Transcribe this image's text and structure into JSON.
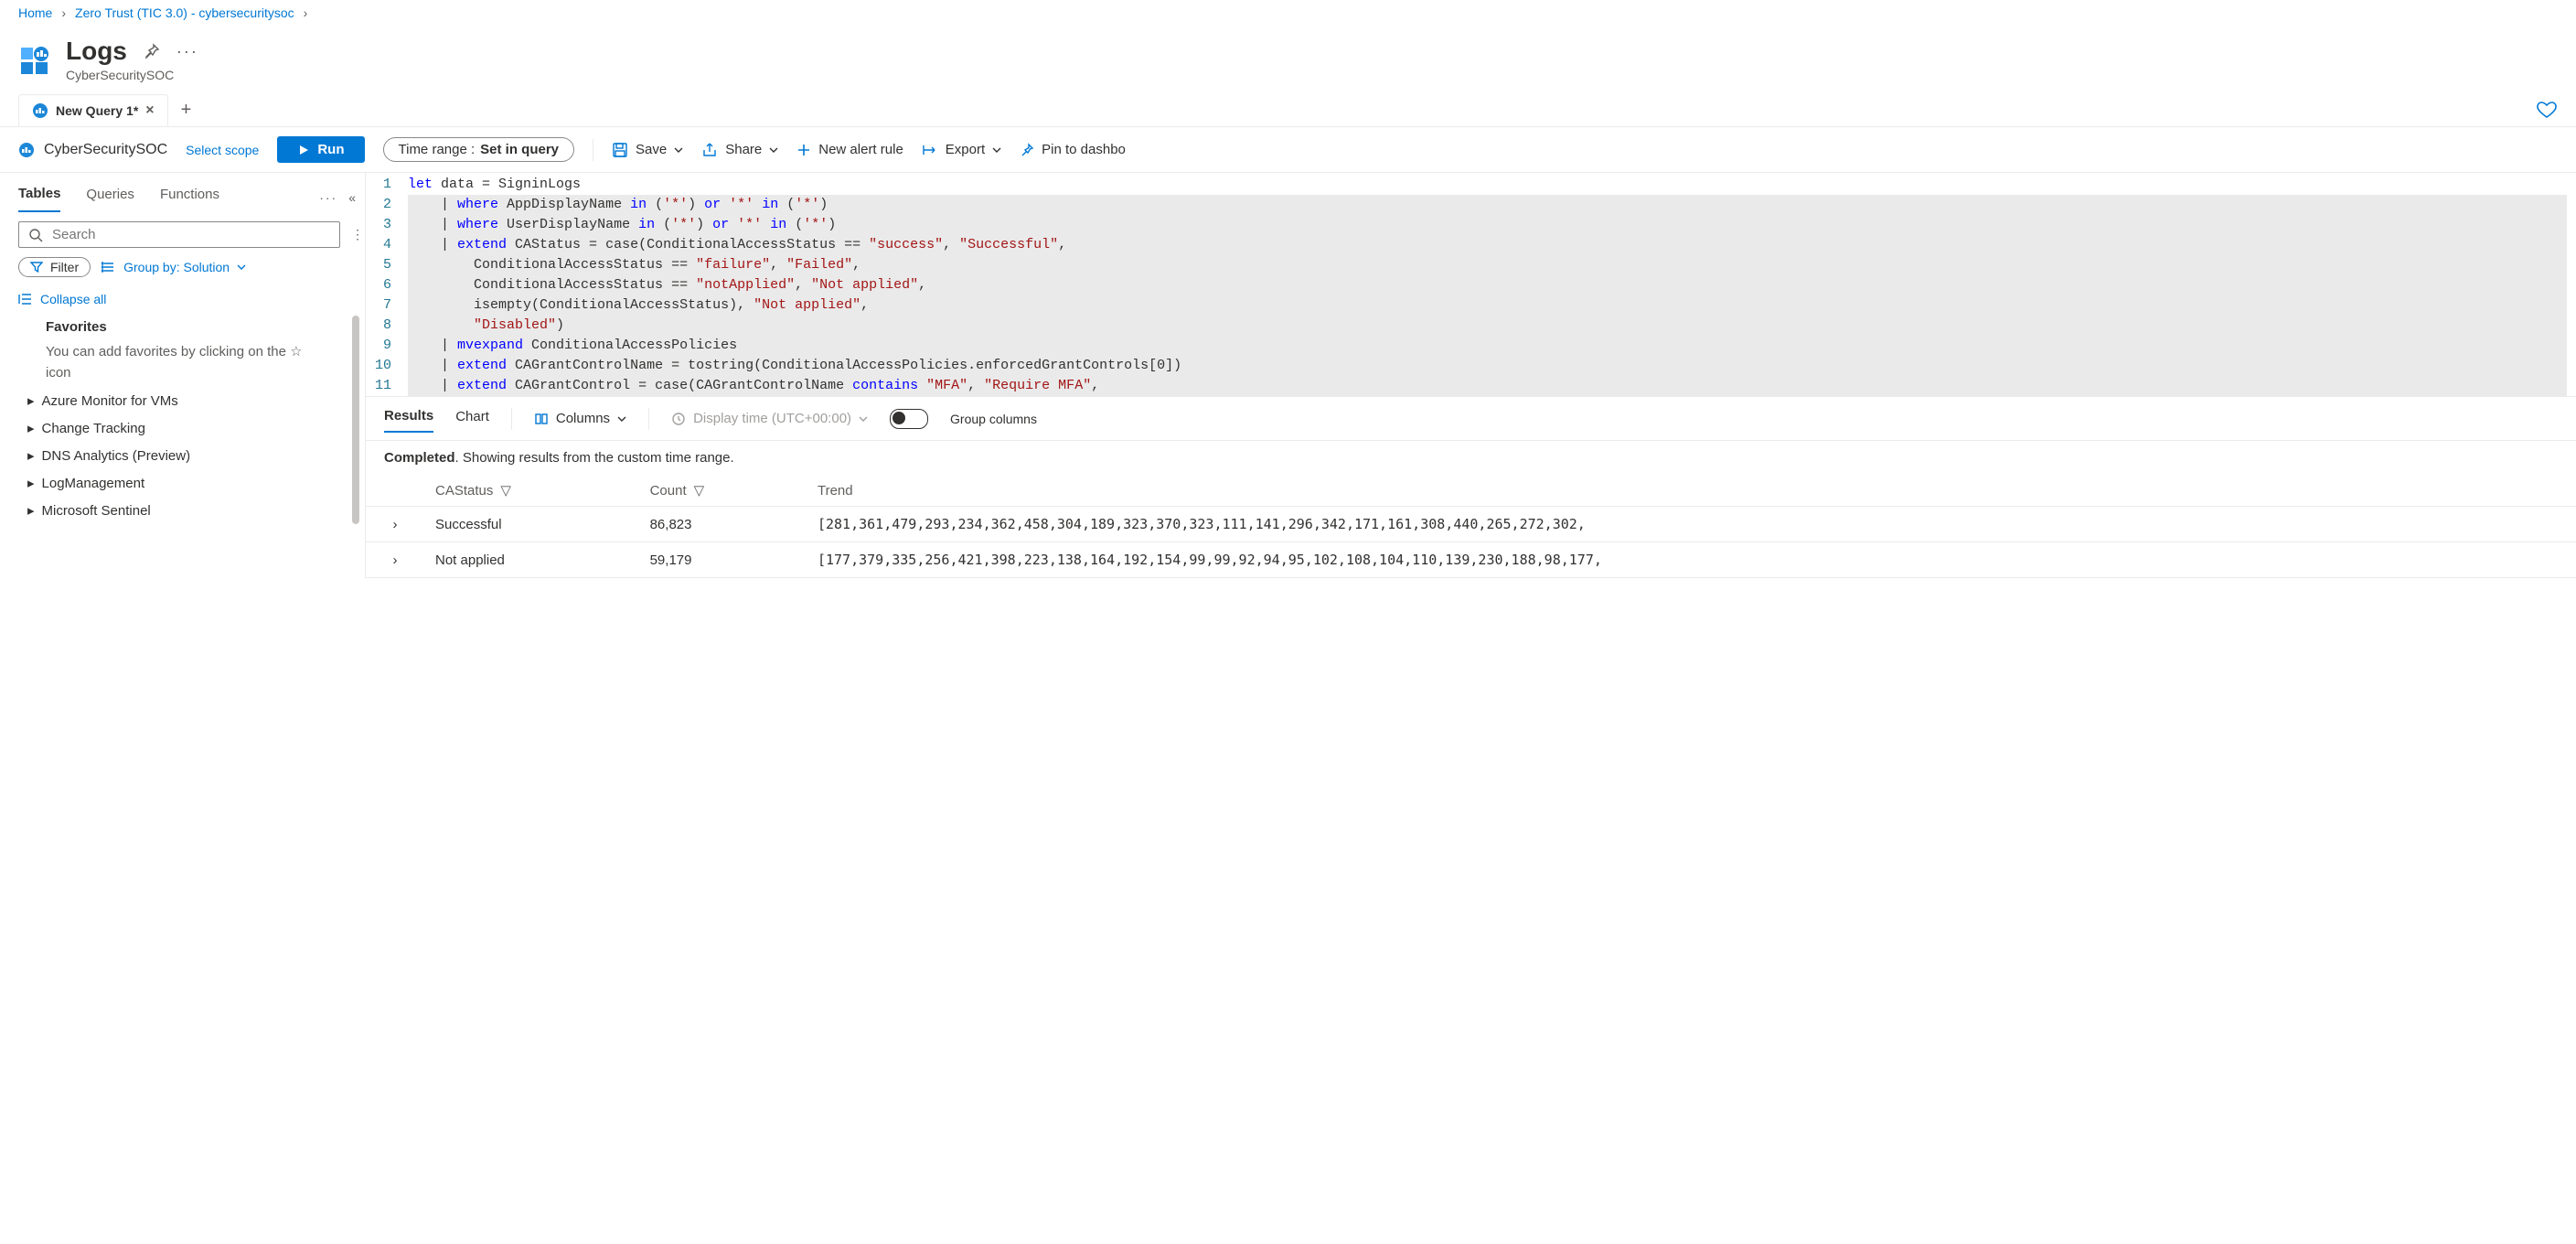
{
  "breadcrumb": {
    "home": "Home",
    "item1": "Zero Trust (TIC 3.0) - cybersecuritysoc"
  },
  "header": {
    "title": "Logs",
    "subtitle": "CyberSecuritySOC"
  },
  "tabs": {
    "active": "New Query 1*"
  },
  "scope": {
    "workspace": "CyberSecuritySOC",
    "select_scope": "Select scope",
    "run": "Run",
    "time_label": "Time range :",
    "time_value": "Set in query",
    "save": "Save",
    "share": "Share",
    "new_alert": "New alert rule",
    "export": "Export",
    "pin": "Pin to dashbo"
  },
  "sidebar": {
    "tabs": {
      "tables": "Tables",
      "queries": "Queries",
      "functions": "Functions"
    },
    "search_placeholder": "Search",
    "filter": "Filter",
    "group_by": "Group by: Solution",
    "collapse_all": "Collapse all",
    "favorites_title": "Favorites",
    "favorites_hint_a": "You can add favorites by clicking on the ",
    "favorites_hint_b": " icon",
    "tree": [
      "Azure Monitor for VMs",
      "Change Tracking",
      "DNS Analytics (Preview)",
      "LogManagement",
      "Microsoft Sentinel"
    ]
  },
  "editor": {
    "lines": [
      {
        "n": 1,
        "segs": [
          [
            "kw",
            "let"
          ],
          [
            "",
            " data = SigninLogs"
          ]
        ]
      },
      {
        "n": 2,
        "segs": [
          [
            "",
            "    | "
          ],
          [
            "kw",
            "where"
          ],
          [
            "",
            " AppDisplayName "
          ],
          [
            "kw",
            "in"
          ],
          [
            "",
            " ("
          ],
          [
            "str",
            "'*'"
          ],
          [
            "",
            ") "
          ],
          [
            "kw",
            "or"
          ],
          [
            "",
            " "
          ],
          [
            "str",
            "'*'"
          ],
          [
            "",
            " "
          ],
          [
            "kw",
            "in"
          ],
          [
            "",
            " ("
          ],
          [
            "str",
            "'*'"
          ],
          [
            "",
            ")"
          ]
        ]
      },
      {
        "n": 3,
        "segs": [
          [
            "",
            "    | "
          ],
          [
            "kw",
            "where"
          ],
          [
            "",
            " UserDisplayName "
          ],
          [
            "kw",
            "in"
          ],
          [
            "",
            " ("
          ],
          [
            "str",
            "'*'"
          ],
          [
            "",
            ") "
          ],
          [
            "kw",
            "or"
          ],
          [
            "",
            " "
          ],
          [
            "str",
            "'*'"
          ],
          [
            "",
            " "
          ],
          [
            "kw",
            "in"
          ],
          [
            "",
            " ("
          ],
          [
            "str",
            "'*'"
          ],
          [
            "",
            ")"
          ]
        ]
      },
      {
        "n": 4,
        "segs": [
          [
            "",
            "    | "
          ],
          [
            "kw",
            "extend"
          ],
          [
            "",
            " CAStatus = case(ConditionalAccessStatus == "
          ],
          [
            "str",
            "\"success\""
          ],
          [
            "",
            ", "
          ],
          [
            "str",
            "\"Successful\""
          ],
          [
            "",
            ","
          ]
        ]
      },
      {
        "n": 5,
        "segs": [
          [
            "",
            "        ConditionalAccessStatus == "
          ],
          [
            "str",
            "\"failure\""
          ],
          [
            "",
            ", "
          ],
          [
            "str",
            "\"Failed\""
          ],
          [
            "",
            ","
          ]
        ]
      },
      {
        "n": 6,
        "segs": [
          [
            "",
            "        ConditionalAccessStatus == "
          ],
          [
            "str",
            "\"notApplied\""
          ],
          [
            "",
            ", "
          ],
          [
            "str",
            "\"Not applied\""
          ],
          [
            "",
            ","
          ]
        ]
      },
      {
        "n": 7,
        "segs": [
          [
            "",
            "        isempty(ConditionalAccessStatus), "
          ],
          [
            "str",
            "\"Not applied\""
          ],
          [
            "",
            ","
          ]
        ]
      },
      {
        "n": 8,
        "segs": [
          [
            "",
            "        "
          ],
          [
            "str",
            "\"Disabled\""
          ],
          [
            "",
            ")"
          ]
        ]
      },
      {
        "n": 9,
        "segs": [
          [
            "",
            "    | "
          ],
          [
            "kw",
            "mvexpand"
          ],
          [
            "",
            " ConditionalAccessPolicies"
          ]
        ]
      },
      {
        "n": 10,
        "segs": [
          [
            "",
            "    | "
          ],
          [
            "kw",
            "extend"
          ],
          [
            "",
            " CAGrantControlName = tostring(ConditionalAccessPolicies.enforcedGrantControls[0])"
          ]
        ]
      },
      {
        "n": 11,
        "segs": [
          [
            "",
            "    | "
          ],
          [
            "kw",
            "extend"
          ],
          [
            "",
            " CAGrantControl = case(CAGrantControlName "
          ],
          [
            "kw",
            "contains"
          ],
          [
            "",
            " "
          ],
          [
            "str",
            "\"MFA\""
          ],
          [
            "",
            ", "
          ],
          [
            "str",
            "\"Require MFA\""
          ],
          [
            "",
            ","
          ]
        ]
      }
    ],
    "highlight_from": 2,
    "highlight_to": 11
  },
  "results": {
    "tab_results": "Results",
    "tab_chart": "Chart",
    "columns": "Columns",
    "display_time": "Display time (UTC+00:00)",
    "group_columns": "Group columns",
    "status_a": "Completed",
    "status_b": ". Showing results from the custom time range.",
    "cols": {
      "c1": "CAStatus",
      "c2": "Count",
      "c3": "Trend"
    },
    "rows": [
      {
        "status": "Successful",
        "count": "86,823",
        "trend": "[281,361,479,293,234,362,458,304,189,323,370,323,111,141,296,342,171,161,308,440,265,272,302,"
      },
      {
        "status": "Not applied",
        "count": "59,179",
        "trend": "[177,379,335,256,421,398,223,138,164,192,154,99,99,92,94,95,102,108,104,110,139,230,188,98,177,"
      }
    ]
  }
}
